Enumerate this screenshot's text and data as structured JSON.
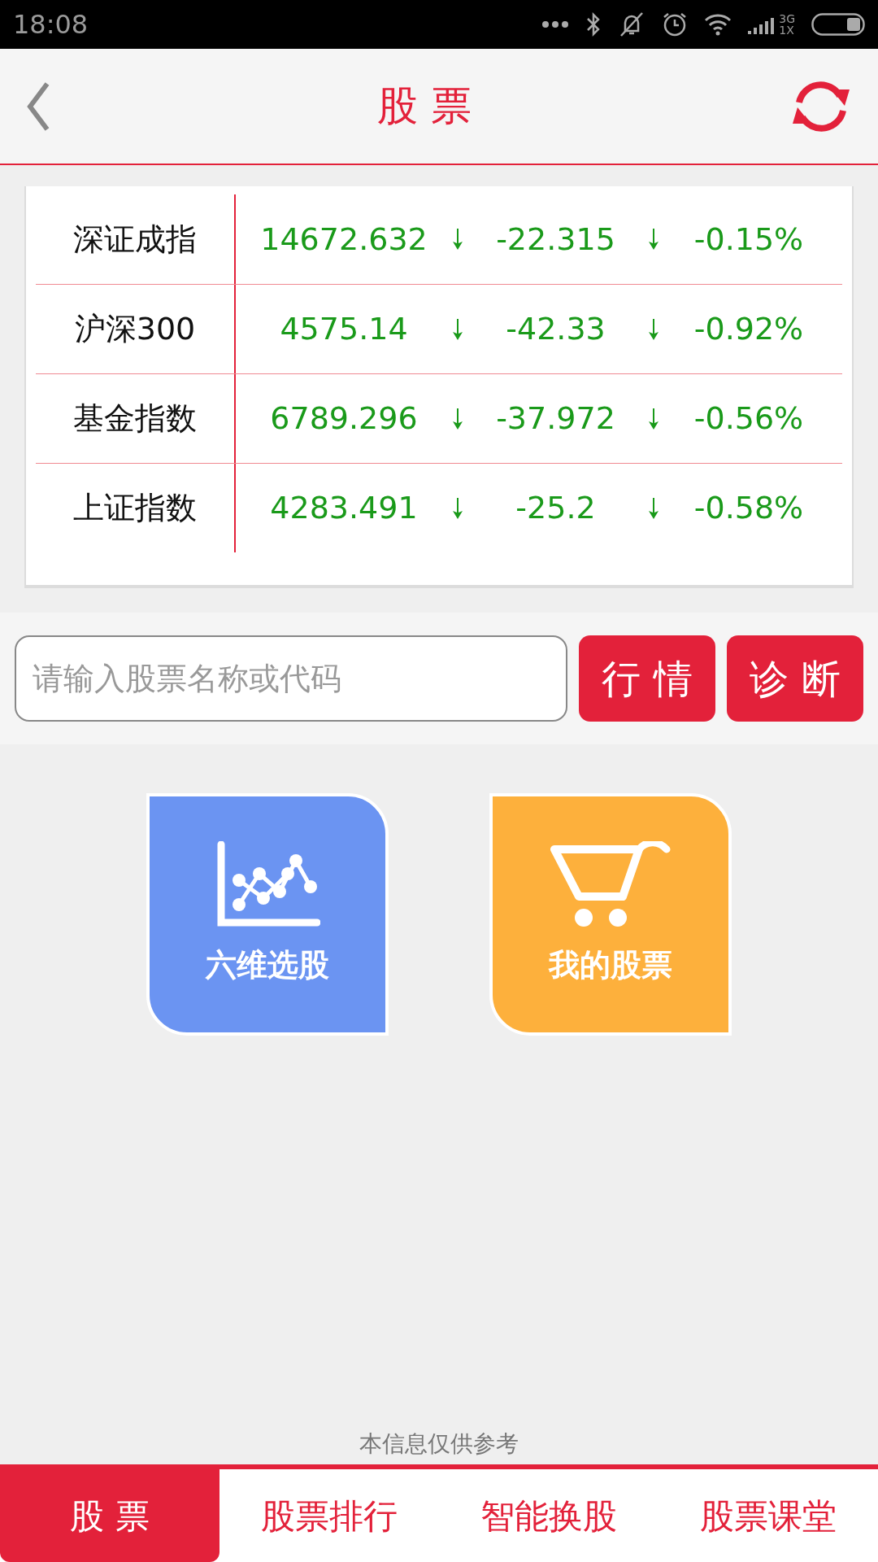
{
  "status_bar": {
    "time": "18:08",
    "network": "3G",
    "network_sub": "1X"
  },
  "header": {
    "title": "股 票"
  },
  "indices": [
    {
      "name": "深证成指",
      "value": "14672.632",
      "change": "-22.315",
      "percent": "-0.15%",
      "falling": true
    },
    {
      "name": "沪深300",
      "value": "4575.14",
      "change": "-42.33",
      "percent": "-0.92%",
      "falling": true
    },
    {
      "name": "基金指数",
      "value": "6789.296",
      "change": "-37.972",
      "percent": "-0.56%",
      "falling": true
    },
    {
      "name": "上证指数",
      "value": "4283.491",
      "change": "-25.2",
      "percent": "-0.58%",
      "falling": true
    }
  ],
  "search": {
    "placeholder": "请输入股票名称或代码",
    "buttons": [
      "行 情",
      "诊 断"
    ]
  },
  "tiles": [
    {
      "label": "六维选股",
      "kind": "chart",
      "color": "#6b94f2"
    },
    {
      "label": "我的股票",
      "kind": "cart",
      "color": "#fdb03c"
    }
  ],
  "footer_note": "本信息仅供参考",
  "tabs": [
    {
      "label": "股 票",
      "selected": true
    },
    {
      "label": "股票排行",
      "selected": false
    },
    {
      "label": "智能换股",
      "selected": false
    },
    {
      "label": "股票课堂",
      "selected": false
    }
  ]
}
